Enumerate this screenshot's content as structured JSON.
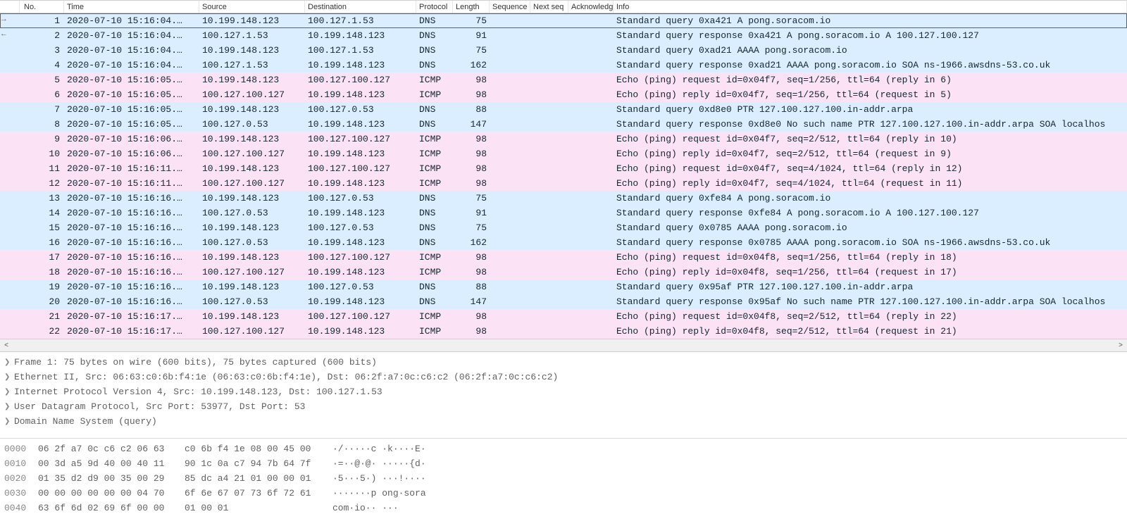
{
  "columns": {
    "no": "No.",
    "time": "Time",
    "src": "Source",
    "dst": "Destination",
    "proto": "Protocol",
    "len": "Length",
    "seq": "Sequence",
    "next": "Next seq",
    "ack": "Acknowledg",
    "info": "Info"
  },
  "packets": [
    {
      "no": 1,
      "time": "2020-07-10 15:16:04.…",
      "src": "10.199.148.123",
      "dst": "100.127.1.53",
      "proto": "DNS",
      "len": 75,
      "info": "Standard query 0xa421 A pong.soracom.io",
      "cls": "dns",
      "sel": true
    },
    {
      "no": 2,
      "time": "2020-07-10 15:16:04.…",
      "src": "100.127.1.53",
      "dst": "10.199.148.123",
      "proto": "DNS",
      "len": 91,
      "info": "Standard query response 0xa421 A pong.soracom.io A 100.127.100.127",
      "cls": "dns"
    },
    {
      "no": 3,
      "time": "2020-07-10 15:16:04.…",
      "src": "10.199.148.123",
      "dst": "100.127.1.53",
      "proto": "DNS",
      "len": 75,
      "info": "Standard query 0xad21 AAAA pong.soracom.io",
      "cls": "dns"
    },
    {
      "no": 4,
      "time": "2020-07-10 15:16:04.…",
      "src": "100.127.1.53",
      "dst": "10.199.148.123",
      "proto": "DNS",
      "len": 162,
      "info": "Standard query response 0xad21 AAAA pong.soracom.io SOA ns-1966.awsdns-53.co.uk",
      "cls": "dns"
    },
    {
      "no": 5,
      "time": "2020-07-10 15:16:05.…",
      "src": "10.199.148.123",
      "dst": "100.127.100.127",
      "proto": "ICMP",
      "len": 98,
      "info": "Echo (ping) request  id=0x04f7, seq=1/256, ttl=64 (reply in 6)",
      "cls": "icmp"
    },
    {
      "no": 6,
      "time": "2020-07-10 15:16:05.…",
      "src": "100.127.100.127",
      "dst": "10.199.148.123",
      "proto": "ICMP",
      "len": 98,
      "info": "Echo (ping) reply    id=0x04f7, seq=1/256, ttl=64 (request in 5)",
      "cls": "icmp"
    },
    {
      "no": 7,
      "time": "2020-07-10 15:16:05.…",
      "src": "10.199.148.123",
      "dst": "100.127.0.53",
      "proto": "DNS",
      "len": 88,
      "info": "Standard query 0xd8e0 PTR 127.100.127.100.in-addr.arpa",
      "cls": "dns"
    },
    {
      "no": 8,
      "time": "2020-07-10 15:16:05.…",
      "src": "100.127.0.53",
      "dst": "10.199.148.123",
      "proto": "DNS",
      "len": 147,
      "info": "Standard query response 0xd8e0 No such name PTR 127.100.127.100.in-addr.arpa SOA localhos",
      "cls": "dns"
    },
    {
      "no": 9,
      "time": "2020-07-10 15:16:06.…",
      "src": "10.199.148.123",
      "dst": "100.127.100.127",
      "proto": "ICMP",
      "len": 98,
      "info": "Echo (ping) request  id=0x04f7, seq=2/512, ttl=64 (reply in 10)",
      "cls": "icmp"
    },
    {
      "no": 10,
      "time": "2020-07-10 15:16:06.…",
      "src": "100.127.100.127",
      "dst": "10.199.148.123",
      "proto": "ICMP",
      "len": 98,
      "info": "Echo (ping) reply    id=0x04f7, seq=2/512, ttl=64 (request in 9)",
      "cls": "icmp"
    },
    {
      "no": 11,
      "time": "2020-07-10 15:16:11.…",
      "src": "10.199.148.123",
      "dst": "100.127.100.127",
      "proto": "ICMP",
      "len": 98,
      "info": "Echo (ping) request  id=0x04f7, seq=4/1024, ttl=64 (reply in 12)",
      "cls": "icmp"
    },
    {
      "no": 12,
      "time": "2020-07-10 15:16:11.…",
      "src": "100.127.100.127",
      "dst": "10.199.148.123",
      "proto": "ICMP",
      "len": 98,
      "info": "Echo (ping) reply    id=0x04f7, seq=4/1024, ttl=64 (request in 11)",
      "cls": "icmp"
    },
    {
      "no": 13,
      "time": "2020-07-10 15:16:16.…",
      "src": "10.199.148.123",
      "dst": "100.127.0.53",
      "proto": "DNS",
      "len": 75,
      "info": "Standard query 0xfe84 A pong.soracom.io",
      "cls": "dns"
    },
    {
      "no": 14,
      "time": "2020-07-10 15:16:16.…",
      "src": "100.127.0.53",
      "dst": "10.199.148.123",
      "proto": "DNS",
      "len": 91,
      "info": "Standard query response 0xfe84 A pong.soracom.io A 100.127.100.127",
      "cls": "dns"
    },
    {
      "no": 15,
      "time": "2020-07-10 15:16:16.…",
      "src": "10.199.148.123",
      "dst": "100.127.0.53",
      "proto": "DNS",
      "len": 75,
      "info": "Standard query 0x0785 AAAA pong.soracom.io",
      "cls": "dns"
    },
    {
      "no": 16,
      "time": "2020-07-10 15:16:16.…",
      "src": "100.127.0.53",
      "dst": "10.199.148.123",
      "proto": "DNS",
      "len": 162,
      "info": "Standard query response 0x0785 AAAA pong.soracom.io SOA ns-1966.awsdns-53.co.uk",
      "cls": "dns"
    },
    {
      "no": 17,
      "time": "2020-07-10 15:16:16.…",
      "src": "10.199.148.123",
      "dst": "100.127.100.127",
      "proto": "ICMP",
      "len": 98,
      "info": "Echo (ping) request  id=0x04f8, seq=1/256, ttl=64 (reply in 18)",
      "cls": "icmp"
    },
    {
      "no": 18,
      "time": "2020-07-10 15:16:16.…",
      "src": "100.127.100.127",
      "dst": "10.199.148.123",
      "proto": "ICMP",
      "len": 98,
      "info": "Echo (ping) reply    id=0x04f8, seq=1/256, ttl=64 (request in 17)",
      "cls": "icmp"
    },
    {
      "no": 19,
      "time": "2020-07-10 15:16:16.…",
      "src": "10.199.148.123",
      "dst": "100.127.0.53",
      "proto": "DNS",
      "len": 88,
      "info": "Standard query 0x95af PTR 127.100.127.100.in-addr.arpa",
      "cls": "dns"
    },
    {
      "no": 20,
      "time": "2020-07-10 15:16:16.…",
      "src": "100.127.0.53",
      "dst": "10.199.148.123",
      "proto": "DNS",
      "len": 147,
      "info": "Standard query response 0x95af No such name PTR 127.100.127.100.in-addr.arpa SOA localhos",
      "cls": "dns"
    },
    {
      "no": 21,
      "time": "2020-07-10 15:16:17.…",
      "src": "10.199.148.123",
      "dst": "100.127.100.127",
      "proto": "ICMP",
      "len": 98,
      "info": "Echo (ping) request  id=0x04f8, seq=2/512, ttl=64 (reply in 22)",
      "cls": "icmp"
    },
    {
      "no": 22,
      "time": "2020-07-10 15:16:17.…",
      "src": "100.127.100.127",
      "dst": "10.199.148.123",
      "proto": "ICMP",
      "len": 98,
      "info": "Echo (ping) reply    id=0x04f8, seq=2/512, ttl=64 (request in 21)",
      "cls": "icmp"
    }
  ],
  "details": [
    "Frame 1: 75 bytes on wire (600 bits), 75 bytes captured (600 bits)",
    "Ethernet II, Src: 06:63:c0:6b:f4:1e (06:63:c0:6b:f4:1e), Dst: 06:2f:a7:0c:c6:c2 (06:2f:a7:0c:c6:c2)",
    "Internet Protocol Version 4, Src: 10.199.148.123, Dst: 100.127.1.53",
    "User Datagram Protocol, Src Port: 53977, Dst Port: 53",
    "Domain Name System (query)"
  ],
  "hex": [
    {
      "off": "0000",
      "b1": "06 2f a7 0c c6 c2 06 63",
      "b2": "c0 6b f4 1e 08 00 45 00",
      "asc": "·/·····c ·k····E·"
    },
    {
      "off": "0010",
      "b1": "00 3d a5 9d 40 00 40 11",
      "b2": "90 1c 0a c7 94 7b 64 7f",
      "asc": "·=··@·@· ·····{d·"
    },
    {
      "off": "0020",
      "b1": "01 35 d2 d9 00 35 00 29",
      "b2": "85 dc a4 21 01 00 00 01",
      "asc": "·5···5·) ···!····"
    },
    {
      "off": "0030",
      "b1": "00 00 00 00 00 00 04 70",
      "b2": "6f 6e 67 07 73 6f 72 61",
      "asc": "·······p ong·sora"
    },
    {
      "off": "0040",
      "b1": "63 6f 6d 02 69 6f 00 00",
      "b2": "01 00 01",
      "asc": "com·io·· ···"
    }
  ]
}
